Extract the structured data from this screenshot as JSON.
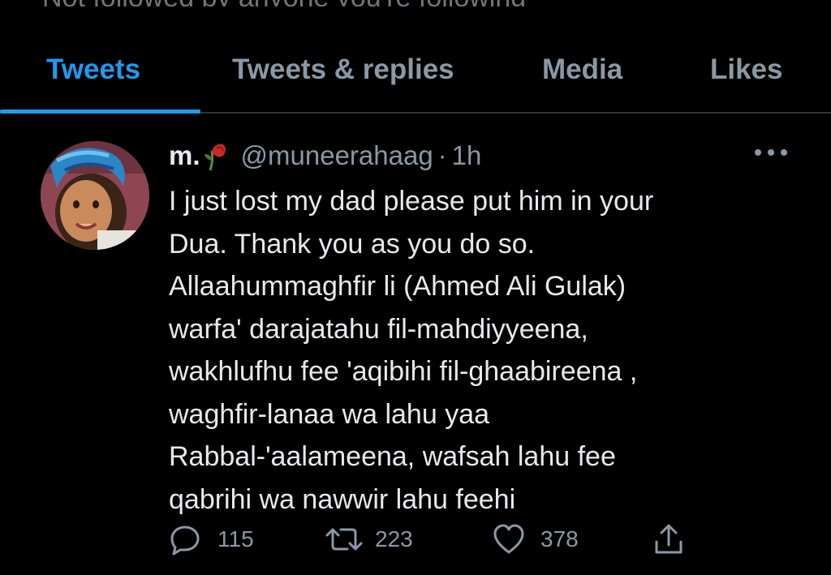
{
  "top_banner": {
    "text": "Not followed by anyone you're following"
  },
  "tabs": [
    {
      "label": "Tweets",
      "active": true
    },
    {
      "label": "Tweets & replies",
      "active": false
    },
    {
      "label": "Media",
      "active": false
    },
    {
      "label": "Likes",
      "active": false
    }
  ],
  "tweet": {
    "display_name": "m.",
    "handle": "@muneerahaag",
    "separator": "·",
    "time": "1h",
    "lines": [
      "I just lost my dad please put him in your",
      "Dua. Thank you as you do so.",
      "Allaahummaghfir li (Ahmed Ali Gulak)",
      "warfa' darajatahu fil-mahdiyyeena,",
      "wakhlufhu fee 'aqibihi fil-ghaabireena ,",
      "waghfir-lanaa wa lahu yaa",
      "Rabbal-'aalameena, wafsah lahu fee",
      "qabrihi wa nawwir lahu feehi"
    ],
    "replies": "115",
    "retweets": "223",
    "likes": "378",
    "icons": {
      "reply": "reply-icon",
      "retweet": "retweet-icon",
      "like": "heart-icon",
      "share": "share-icon",
      "more": "more-icon",
      "emoji": "wilted-rose-icon"
    }
  },
  "colors": {
    "background": "#000000",
    "accent": "#1d9bf0",
    "text": "#e7e9ea",
    "secondary": "#8b98a5",
    "divider": "#2f3336"
  }
}
